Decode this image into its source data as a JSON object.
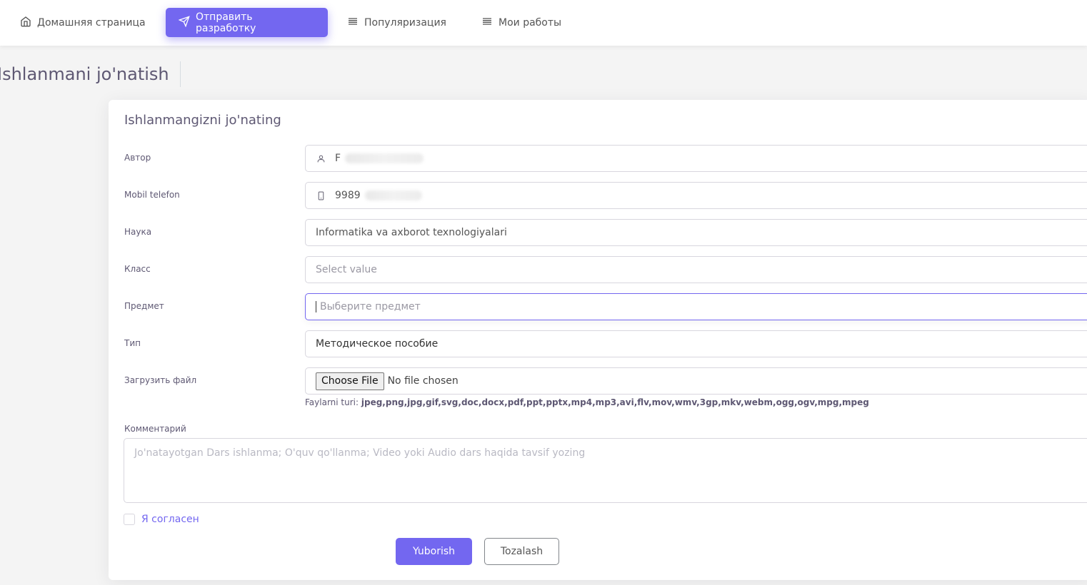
{
  "nav": {
    "home": "Домашняя страница",
    "submit": "Отправить разработку",
    "popularization": "Популяризация",
    "my_works": "Мои работы"
  },
  "page": {
    "title": "Ishlanmani jo'natish"
  },
  "form": {
    "title": "Ishlanmangizni jo'nating",
    "author": {
      "label": "Автор",
      "value": "F"
    },
    "phone": {
      "label": "Mobil telefon",
      "value": "9989"
    },
    "science": {
      "label": "Наука",
      "value": "Informatika va axborot texnologiyalari"
    },
    "class": {
      "label": "Класс",
      "placeholder": "Select value"
    },
    "subject": {
      "label": "Предмет",
      "placeholder": "Выберите предмет"
    },
    "type": {
      "label": "Тип",
      "value": "Методическое пособие"
    },
    "file": {
      "label": "Загрузить файл",
      "button": "Choose File",
      "status": "No file chosen",
      "types_label": "Faylarni turi:",
      "types": "jpeg,png,jpg,gif,svg,doc,docx,pdf,ppt,pptx,mp4,mp3,avi,flv,mov,wmv,3gp,mkv,webm,ogg,ogv,mpg,mpeg"
    },
    "comment": {
      "label": "Комментарий",
      "placeholder": "Jo'natayotgan Dars ishlanma; O'quv qo'llanma; Video yoki Audio dars haqida tavsif yozing"
    },
    "agree": "Я согласен",
    "submit_button": "Yuborish",
    "reset_button": "Tozalash"
  },
  "colors": {
    "accent": "#7367f0",
    "heading": "#5e5873",
    "border": "#d8d6de"
  }
}
